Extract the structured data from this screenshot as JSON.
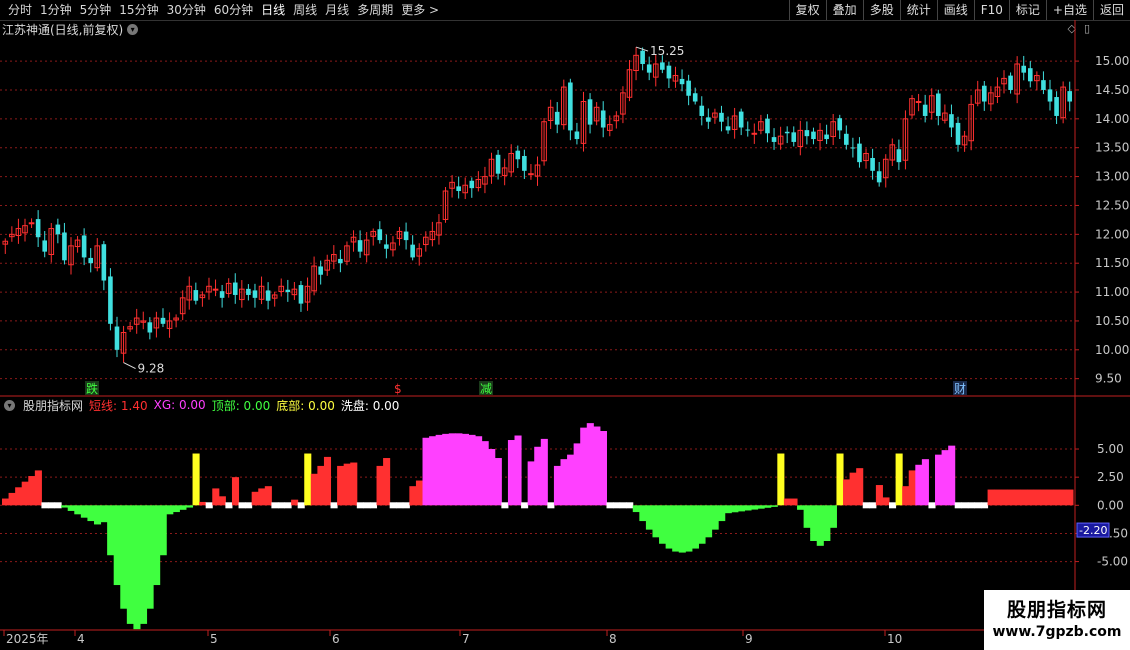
{
  "toolbar": {
    "periods": [
      "分时",
      "1分钟",
      "5分钟",
      "15分钟",
      "30分钟",
      "60分钟",
      "日线",
      "周线",
      "月线",
      "多周期",
      "更多 >"
    ],
    "active_period": "日线",
    "right_buttons": [
      "复权",
      "叠加",
      "多股",
      "统计",
      "画线",
      "F10",
      "标记",
      "+自选",
      "返回"
    ]
  },
  "stock": {
    "title": "江苏神通(日线,前复权)"
  },
  "indicator": {
    "name": "股朋指标网",
    "fields": [
      {
        "label": "短线:",
        "value": "1.40",
        "color": "#ff3030"
      },
      {
        "label": "XG:",
        "value": "0.00",
        "color": "#ff40ff"
      },
      {
        "label": "顶部:",
        "value": "0.00",
        "color": "#40ff40"
      },
      {
        "label": "底部:",
        "value": "0.00",
        "color": "#ffff40"
      },
      {
        "label": "洗盘:",
        "value": "0.00",
        "color": "#ffffff"
      }
    ],
    "current_value_box": "-2.20"
  },
  "price_axis": [
    "15.00",
    "14.50",
    "14.00",
    "13.50",
    "13.00",
    "12.50",
    "12.00",
    "11.50",
    "11.00",
    "10.50",
    "10.00",
    "9.50"
  ],
  "indicator_axis": [
    "5.00",
    "2.50",
    "0.00",
    "-2.50",
    "-5.00"
  ],
  "date_axis": [
    {
      "label": "2025年"
    },
    {
      "label": "4"
    },
    {
      "label": "5"
    },
    {
      "label": "6"
    },
    {
      "label": "7"
    },
    {
      "label": "8"
    },
    {
      "label": "9"
    },
    {
      "label": "10"
    }
  ],
  "annotations": {
    "high_label": "15.25",
    "low_label": "9.28",
    "markers": [
      {
        "text": "跌",
        "color": "#40ff40",
        "bg": "#1a3a1a"
      },
      {
        "text": "$",
        "color": "#ff3030",
        "bg": "transparent"
      },
      {
        "text": "减",
        "color": "#40ff40",
        "bg": "#1a3a1a"
      },
      {
        "text": "财",
        "color": "#80c0ff",
        "bg": "#1a2a4a"
      }
    ]
  },
  "watermark": {
    "line1": "股朋指标网",
    "line2": "www.7gpzb.com"
  },
  "colors": {
    "up": "#ff3030",
    "down": "#40e0e0",
    "grid": "#8b1a1a",
    "axis": "#c02020"
  },
  "chart_data": {
    "type": "candlestick",
    "ylim": [
      9.2,
      15.4
    ],
    "closes": [
      11.88,
      12.0,
      12.1,
      12.15,
      12.2,
      11.95,
      11.7,
      12.1,
      12.0,
      11.55,
      11.8,
      11.9,
      11.6,
      11.5,
      11.8,
      11.2,
      10.45,
      10.0,
      10.3,
      10.4,
      10.55,
      10.5,
      10.3,
      10.55,
      10.45,
      10.5,
      10.55,
      10.9,
      11.1,
      10.85,
      10.95,
      11.1,
      11.05,
      10.9,
      11.15,
      10.95,
      11.05,
      10.95,
      10.9,
      11.1,
      10.85,
      10.95,
      11.1,
      11.0,
      11.05,
      10.8,
      11.1,
      11.45,
      11.3,
      11.55,
      11.65,
      11.5,
      11.8,
      11.95,
      11.7,
      11.9,
      12.05,
      11.9,
      11.75,
      11.85,
      12.05,
      11.9,
      11.6,
      11.75,
      11.95,
      12.05,
      12.2,
      12.75,
      12.9,
      12.75,
      12.85,
      12.8,
      12.95,
      13.0,
      13.3,
      13.05,
      13.15,
      13.4,
      13.3,
      13.1,
      13.05,
      13.2,
      13.95,
      14.2,
      13.9,
      14.55,
      13.8,
      13.65,
      14.3,
      13.9,
      14.2,
      13.85,
      13.9,
      14.05,
      14.45,
      14.85,
      15.1,
      14.95,
      14.8,
      14.95,
      14.85,
      14.7,
      14.75,
      14.6,
      14.4,
      14.3,
      14.05,
      13.95,
      14.1,
      13.95,
      13.8,
      14.05,
      13.85,
      13.8,
      13.75,
      13.95,
      13.75,
      13.6,
      13.7,
      13.75,
      13.6,
      13.8,
      13.7,
      13.65,
      13.8,
      13.65,
      13.95,
      13.8,
      13.55,
      13.5,
      13.25,
      13.4,
      13.1,
      12.9,
      13.3,
      13.55,
      13.25,
      14.0,
      14.35,
      14.3,
      14.05,
      14.4,
      14.05,
      14.1,
      13.85,
      13.55,
      13.7,
      14.25,
      14.5,
      14.3,
      14.45,
      14.55,
      14.7,
      14.5,
      14.95,
      14.8,
      14.65,
      14.75,
      14.5,
      14.3,
      14.05,
      14.55,
      14.3
    ]
  }
}
